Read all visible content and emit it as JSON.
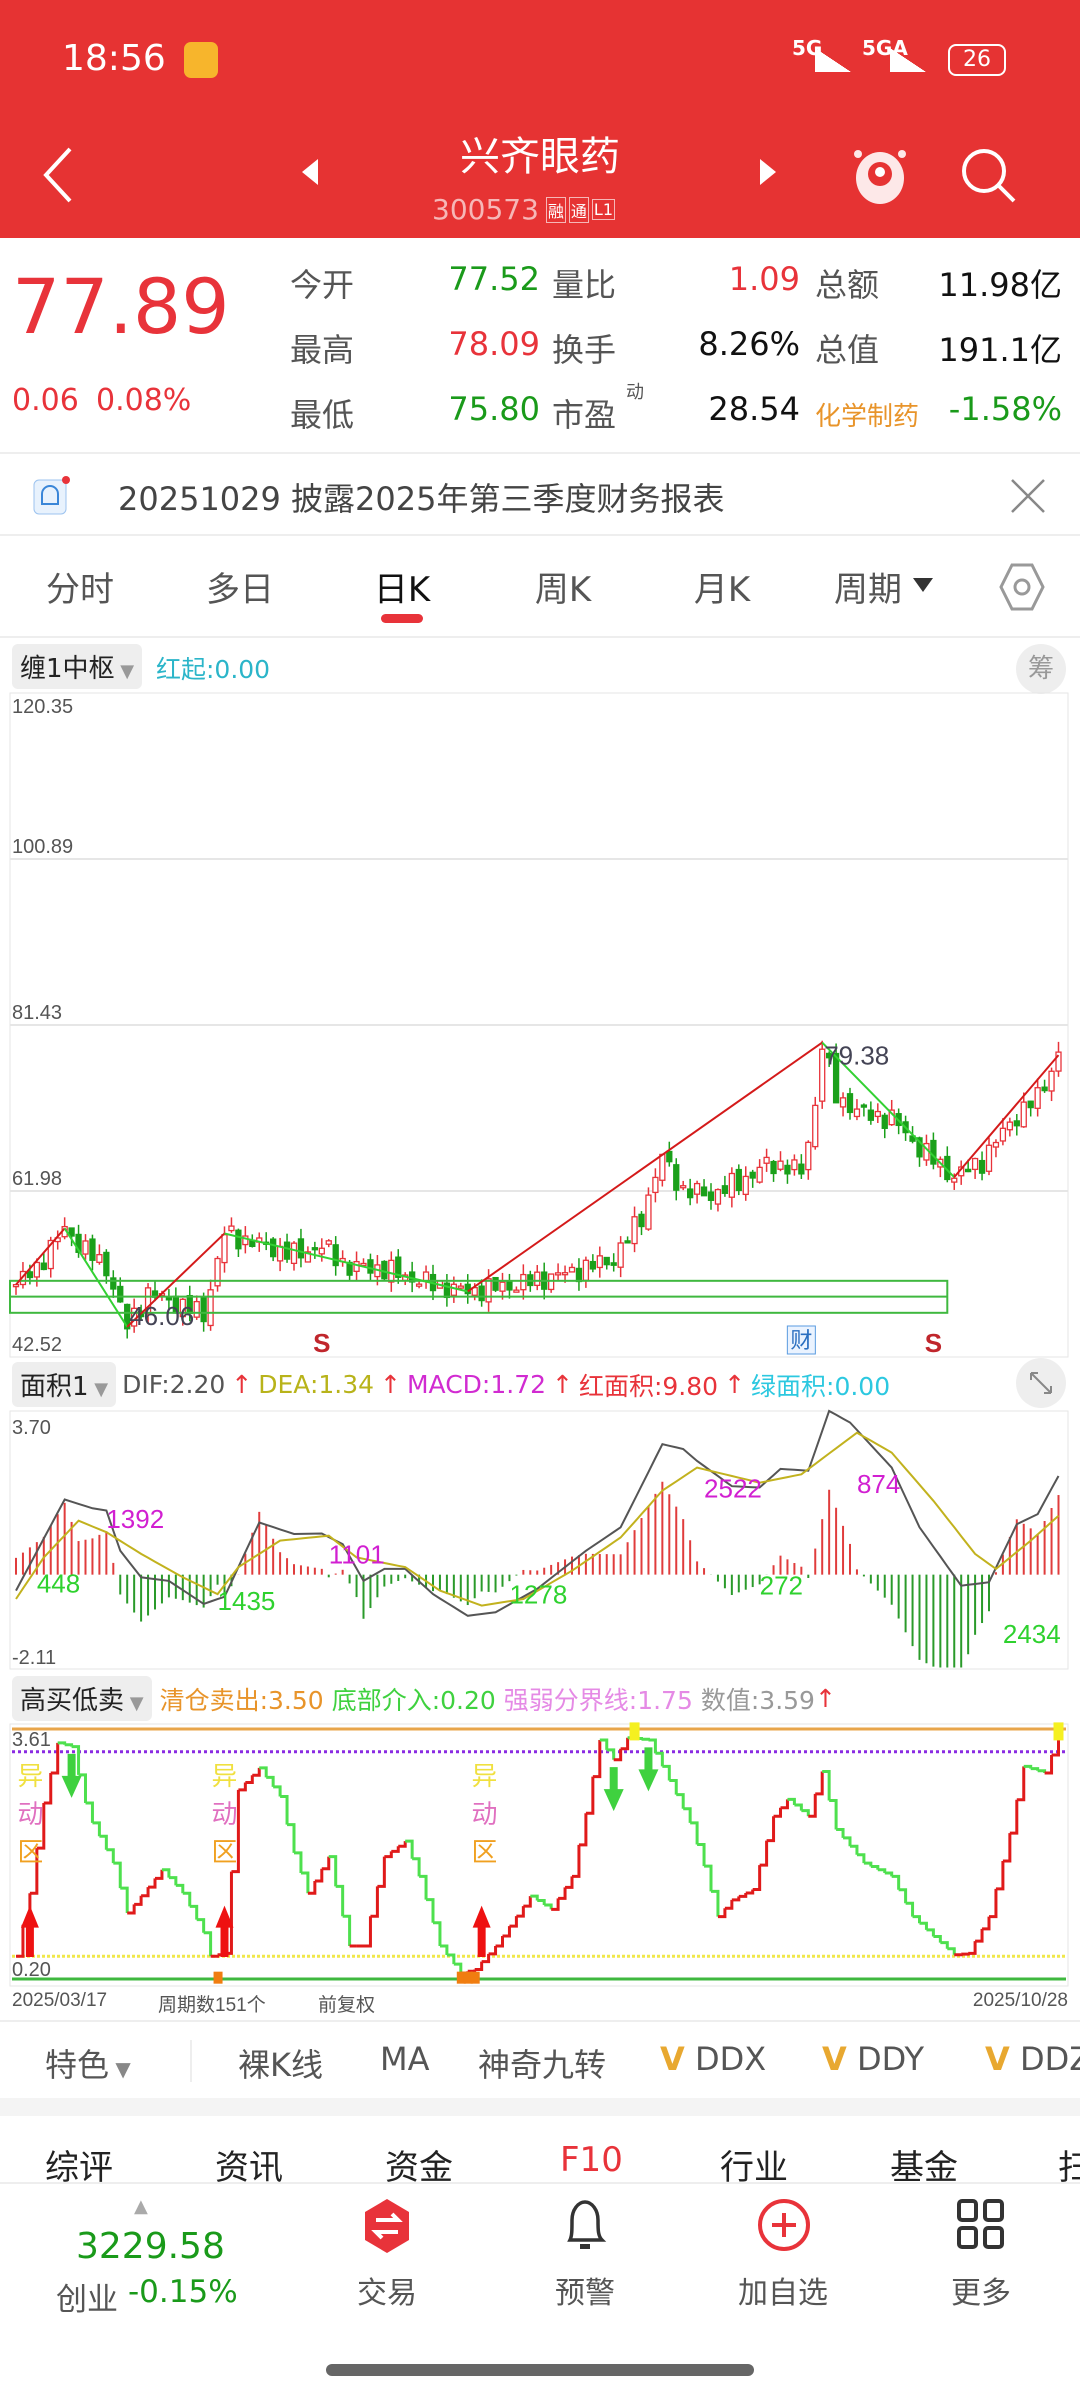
{
  "status": {
    "time": "18:56",
    "net1": "5G",
    "net2": "5GA",
    "battery": "26"
  },
  "header": {
    "title": "兴齐眼药",
    "code": "300573",
    "badges": [
      "融",
      "通",
      "L1"
    ]
  },
  "quote": {
    "price": "77.89",
    "change": "0.06",
    "change_pct": "0.08%",
    "rows": [
      {
        "l1": "今开",
        "v1": "77.52",
        "l2": "量比",
        "v2": "1.09",
        "l3": "总额",
        "v3": "11.98亿"
      },
      {
        "l1": "最高",
        "v1": "78.09",
        "l2": "换手",
        "v2": "8.26%",
        "l3": "总值",
        "v3": "191.1亿"
      },
      {
        "l1": "最低",
        "v1": "75.80",
        "l2": "市盈",
        "l2_sup": "动",
        "v2": "28.54",
        "l3": "化学制药",
        "v3": "-1.58%"
      }
    ]
  },
  "notice": {
    "text": "20251029 披露2025年第三季度财务报表"
  },
  "tabs": [
    "分时",
    "多日",
    "日K",
    "周K",
    "月K",
    "周期"
  ],
  "active_tab": "日K",
  "main_indicator": {
    "name": "缠1中枢",
    "param": "红起:0.00",
    "chip_button": "筹"
  },
  "macd_indicator": {
    "name": "面积1",
    "dif": "DIF:2.20",
    "dea": "DEA:1.34",
    "macd": "MACD:1.72",
    "red_area": "红面积:9.80",
    "green_area": "绿面积:0.00"
  },
  "sub_indicator": {
    "name": "高买低卖",
    "sell": "清仓卖出:3.50",
    "buy": "底部介入:0.20",
    "divider": "强弱分界线:1.75",
    "value": "数值:3.59"
  },
  "footer": {
    "start_date": "2025/03/17",
    "periods": "周期数151个",
    "adjust": "前复权",
    "end_date": "2025/10/28"
  },
  "features": {
    "menu": "特色",
    "items": [
      "裸K线",
      "MA",
      "神奇九转",
      "DDX",
      "DDY",
      "DDZ"
    ],
    "v_badge": "V"
  },
  "bottom_tabs": [
    "综评",
    "资讯",
    "资金",
    "F10",
    "行业",
    "基金",
    "扫"
  ],
  "nav": {
    "index_value": "3229.58",
    "index_name": "创业",
    "index_change": "-0.15%",
    "items": [
      "交易",
      "预警",
      "加自选",
      "更多"
    ]
  },
  "colors": {
    "red": "#e8333a",
    "green": "#1a9a1a",
    "header": "#e63333",
    "orange": "#e8942a"
  },
  "chart_data": [
    {
      "type": "candlestick",
      "name": "price",
      "bars": 151,
      "y_ticks": [
        "120.35",
        "100.89",
        "81.43",
        "61.98",
        "42.52"
      ],
      "ylim": [
        42.52,
        120.35
      ],
      "close_keypoints": [
        [
          0,
          51
        ],
        [
          3,
          53
        ],
        [
          7,
          57.6
        ],
        [
          10,
          55
        ],
        [
          13,
          53
        ],
        [
          16,
          46.06
        ],
        [
          19,
          50
        ],
        [
          24,
          48.5
        ],
        [
          27,
          47.5
        ],
        [
          30,
          57
        ],
        [
          34,
          56
        ],
        [
          40,
          54.5
        ],
        [
          44,
          55.5
        ],
        [
          48,
          53
        ],
        [
          52,
          53
        ],
        [
          56,
          52
        ],
        [
          60,
          51
        ],
        [
          65,
          50.2
        ],
        [
          72,
          51
        ],
        [
          80,
          52.5
        ],
        [
          86,
          54
        ],
        [
          90,
          59
        ],
        [
          93,
          66
        ],
        [
          96,
          62
        ],
        [
          100,
          61.5
        ],
        [
          104,
          63
        ],
        [
          108,
          65
        ],
        [
          111,
          65
        ],
        [
          113,
          64
        ],
        [
          115,
          72
        ],
        [
          116,
          79.38
        ],
        [
          118,
          73
        ],
        [
          122,
          71
        ],
        [
          126,
          70.5
        ],
        [
          130,
          67
        ],
        [
          135,
          63.6
        ],
        [
          139,
          65.5
        ],
        [
          143,
          70
        ],
        [
          147,
          73
        ],
        [
          150,
          77.9
        ]
      ],
      "zigzag": [
        [
          0,
          51
        ],
        [
          7,
          57.6
        ],
        [
          16,
          46.06
        ],
        [
          30,
          57
        ],
        [
          65,
          50.2
        ],
        [
          116,
          79.38
        ],
        [
          135,
          63.6
        ],
        [
          150,
          77.9
        ]
      ],
      "pivot_zone": {
        "start_bar": 0,
        "end_bar": 134,
        "high": 51.45,
        "mid": 49.6,
        "low": 47.7
      },
      "annotations": [
        {
          "bar": 116,
          "value": 79.38,
          "text": "79.38"
        },
        {
          "bar": 16,
          "value": 46.06,
          "text": "46.06"
        }
      ],
      "markers": [
        {
          "bar": 44,
          "text": "S"
        },
        {
          "bar": 113,
          "text": "财"
        },
        {
          "bar": 132,
          "text": "S"
        }
      ]
    },
    {
      "type": "macd",
      "name": "面积1",
      "ylim": [
        -2.11,
        3.7
      ],
      "y_ticks": [
        "3.70",
        "-2.11"
      ],
      "dif": [
        [
          0,
          -0.36
        ],
        [
          7,
          1.7
        ],
        [
          11,
          1.5
        ],
        [
          13,
          1.45
        ],
        [
          15,
          0.54
        ],
        [
          18,
          -0.06
        ],
        [
          22,
          -0.14
        ],
        [
          27,
          -0.66
        ],
        [
          30,
          -0.5
        ],
        [
          35,
          1.18
        ],
        [
          40,
          0.92
        ],
        [
          44,
          0.93
        ],
        [
          47,
          0.69
        ],
        [
          50,
          -0.14
        ],
        [
          53,
          0.13
        ],
        [
          56,
          0.13
        ],
        [
          60,
          -0.44
        ],
        [
          65,
          -0.93
        ],
        [
          69,
          -0.85
        ],
        [
          75,
          -0.32
        ],
        [
          82,
          0.54
        ],
        [
          87,
          1.07
        ],
        [
          93,
          2.95
        ],
        [
          96,
          2.84
        ],
        [
          98,
          2.57
        ],
        [
          103,
          2.0
        ],
        [
          107,
          1.97
        ],
        [
          110,
          2.39
        ],
        [
          114,
          2.35
        ],
        [
          117,
          3.7
        ],
        [
          120,
          3.44
        ],
        [
          126,
          2.42
        ],
        [
          130,
          1.07
        ],
        [
          136,
          -0.25
        ],
        [
          140,
          -0.17
        ],
        [
          144,
          1.14
        ],
        [
          147,
          1.37
        ],
        [
          150,
          2.23
        ]
      ],
      "dea": [
        [
          0,
          -0.55
        ],
        [
          4,
          0.39
        ],
        [
          9,
          1.22
        ],
        [
          13,
          0.96
        ],
        [
          18,
          0.47
        ],
        [
          24,
          -0.06
        ],
        [
          29,
          -0.44
        ],
        [
          32,
          0.17
        ],
        [
          38,
          0.77
        ],
        [
          45,
          0.88
        ],
        [
          49,
          0.39
        ],
        [
          56,
          0.17
        ],
        [
          61,
          -0.36
        ],
        [
          67,
          -0.7
        ],
        [
          73,
          -0.55
        ],
        [
          80,
          0.09
        ],
        [
          87,
          0.84
        ],
        [
          93,
          1.9
        ],
        [
          98,
          2.42
        ],
        [
          103,
          2.23
        ],
        [
          107,
          2.08
        ],
        [
          113,
          2.27
        ],
        [
          121,
          3.21
        ],
        [
          126,
          2.76
        ],
        [
          132,
          1.67
        ],
        [
          138,
          0.47
        ],
        [
          141,
          0.13
        ],
        [
          146,
          0.77
        ],
        [
          150,
          1.33
        ]
      ],
      "labels": [
        {
          "bar": 3,
          "value": -0.4,
          "text": "448",
          "color": "green"
        },
        {
          "bar": 13,
          "value": 1.05,
          "text": "1392",
          "color": "magenta"
        },
        {
          "bar": 29,
          "value": -0.8,
          "text": "1435",
          "color": "green"
        },
        {
          "bar": 45,
          "value": 0.25,
          "text": "1101",
          "color": "magenta"
        },
        {
          "bar": 71,
          "value": -0.65,
          "text": "1278",
          "color": "green"
        },
        {
          "bar": 99,
          "value": 1.75,
          "text": "2522",
          "color": "magenta"
        },
        {
          "bar": 107,
          "value": -0.45,
          "text": "272",
          "color": "green"
        },
        {
          "bar": 121,
          "value": 1.85,
          "text": "874",
          "color": "magenta"
        },
        {
          "bar": 142,
          "value": -1.55,
          "text": "2434",
          "color": "green"
        }
      ]
    },
    {
      "type": "step_line",
      "name": "高买低卖",
      "ylim": [
        0.2,
        3.61
      ],
      "y_ticks": [
        "3.61",
        "0.20"
      ],
      "levels": {
        "sell": 3.5,
        "strong": 3.3,
        "bottom_warn": 0.51,
        "buy": 0.2
      },
      "values": [
        [
          0,
          0.51
        ],
        [
          2,
          1.37
        ],
        [
          4,
          2.6
        ],
        [
          6,
          3.42
        ],
        [
          8,
          3.37
        ],
        [
          10,
          2.6
        ],
        [
          11,
          2.33
        ],
        [
          14,
          1.78
        ],
        [
          16,
          1.1
        ],
        [
          21,
          1.69
        ],
        [
          24,
          1.37
        ],
        [
          27,
          0.83
        ],
        [
          28,
          0.51
        ],
        [
          30,
          0.55
        ],
        [
          32,
          2.78
        ],
        [
          35,
          3.08
        ],
        [
          38,
          2.69
        ],
        [
          40,
          1.92
        ],
        [
          42,
          1.37
        ],
        [
          45,
          1.87
        ],
        [
          48,
          0.65
        ],
        [
          50,
          0.65
        ],
        [
          53,
          1.87
        ],
        [
          56,
          2.08
        ],
        [
          58,
          1.6
        ],
        [
          61,
          0.65
        ],
        [
          64,
          0.28
        ],
        [
          66,
          0.33
        ],
        [
          69,
          0.65
        ],
        [
          74,
          1.33
        ],
        [
          77,
          1.15
        ],
        [
          80,
          1.6
        ],
        [
          82,
          2.46
        ],
        [
          84,
          3.46
        ],
        [
          86,
          3.19
        ],
        [
          88,
          3.49
        ],
        [
          91,
          3.46
        ],
        [
          93,
          3.1
        ],
        [
          97,
          2.33
        ],
        [
          99,
          1.74
        ],
        [
          101,
          1.05
        ],
        [
          103,
          1.28
        ],
        [
          106,
          1.42
        ],
        [
          109,
          2.42
        ],
        [
          111,
          2.65
        ],
        [
          114,
          2.42
        ],
        [
          116,
          3.03
        ],
        [
          118,
          2.24
        ],
        [
          122,
          1.78
        ],
        [
          126,
          1.6
        ],
        [
          129,
          1.05
        ],
        [
          132,
          0.78
        ],
        [
          135,
          0.53
        ],
        [
          137,
          0.55
        ],
        [
          140,
          1.05
        ],
        [
          143,
          2.19
        ],
        [
          145,
          3.1
        ],
        [
          148,
          3.01
        ],
        [
          150,
          3.5
        ]
      ],
      "zone_label": "异动区",
      "zone_bars": [
        2,
        30,
        67
      ],
      "up_arrows": [
        2,
        30,
        67
      ],
      "down_arrows": [
        8,
        86,
        91
      ]
    }
  ]
}
